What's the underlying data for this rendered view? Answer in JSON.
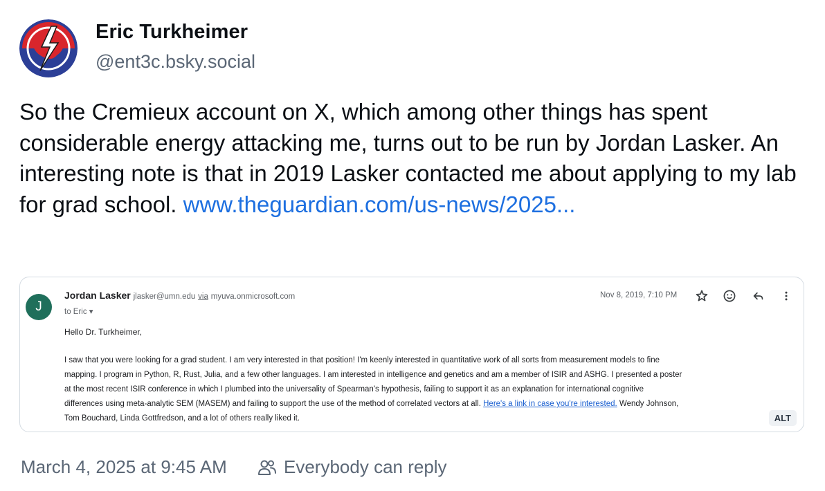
{
  "author": {
    "name": "Eric Turkheimer",
    "handle": "@ent3c.bsky.social",
    "avatar_icon": "steal-your-face-lightning-icon"
  },
  "post": {
    "text": "So the Cremieux account on X, which among other things has spent considerable energy attacking me, turns out to be run by Jordan Lasker. An interesting note is that in 2019 Lasker contacted me about applying to my lab for grad school.",
    "link": "www.theguardian.com/us-news/2025..."
  },
  "embed": {
    "avatar_letter": "J",
    "sender_name": "Jordan Lasker",
    "sender_email": "jlasker@umn.edu",
    "via_label": "via",
    "via_domain": "myuva.onmicrosoft.com",
    "to": "to Eric",
    "date": "Nov 8, 2019, 7:10 PM",
    "greeting": "Hello Dr. Turkheimer,",
    "body_lines": [
      "I saw that you were looking for a grad student. I am very interested in that position! I'm keenly interested in quantitative work of all sorts from measurement models to fine",
      "mapping. I program in Python, R, Rust, Julia, and a few other languages. I am interested in intelligence and genetics and am a member of ISIR and ASHG. I presented a poster",
      "at the most recent ISIR conference in which I plumbed into the universality of Spearman's hypothesis, failing to support it as an explanation for international cognitive",
      "differences using meta-analytic SEM (MASEM) and failing to support the use of the method of correlated vectors at all."
    ],
    "link_text": "Here's a link in case you're interested.",
    "line4_tail": " Wendy Johnson,",
    "body_last_line": "Tom Bouchard, Linda Gottfredson, and a lot of others really liked it.",
    "alt_label": "ALT",
    "icons": [
      "star-icon",
      "smiley-icon",
      "reply-icon",
      "more-vert-icon"
    ]
  },
  "footer": {
    "timestamp": "March 4, 2025 at 9:45 AM",
    "reply_setting": "Everybody can reply"
  },
  "colors": {
    "link": "#1d6fe0",
    "muted": "#5b6776",
    "avatar_red": "#d9262c",
    "avatar_blue": "#2c3f97",
    "email_avatar": "#1f6f5b"
  }
}
